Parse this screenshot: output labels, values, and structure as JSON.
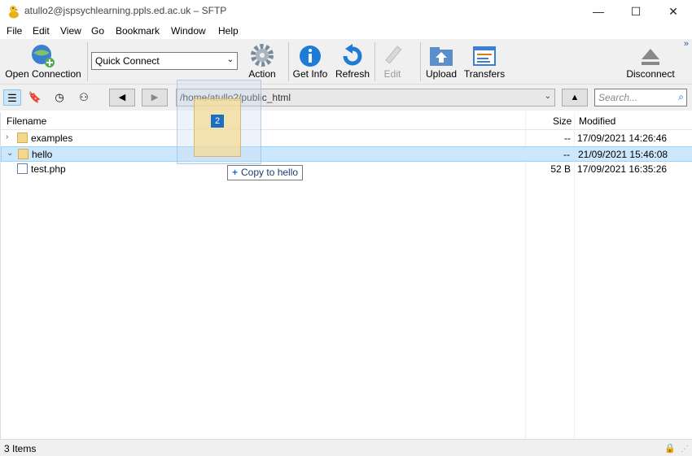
{
  "window": {
    "title": "atullo2@jspsychlearning.ppls.ed.ac.uk – SFTP",
    "minimize": "—",
    "maximize": "☐",
    "close": "✕"
  },
  "menu": [
    "File",
    "Edit",
    "View",
    "Go",
    "Bookmark",
    "Window",
    "Help"
  ],
  "toolbar": {
    "open_connection": "Open Connection",
    "quick_connect": "Quick Connect",
    "action": "Action",
    "get_info": "Get Info",
    "refresh": "Refresh",
    "edit": "Edit",
    "upload": "Upload",
    "transfers": "Transfers",
    "disconnect": "Disconnect",
    "more": "»"
  },
  "navbar": {
    "path": "/home/atullo2/public_html",
    "search_placeholder": "Search..."
  },
  "list": {
    "columns": {
      "filename": "Filename",
      "size": "Size",
      "modified": "Modified"
    },
    "rows": [
      {
        "name": "examples",
        "size": "--",
        "modified": "17/09/2021 14:26:46",
        "type": "folder",
        "expander": "›"
      },
      {
        "name": "hello",
        "size": "--",
        "modified": "21/09/2021 15:46:08",
        "type": "folder",
        "expander": "⌄"
      },
      {
        "name": "test.php",
        "size": "52 B",
        "modified": "17/09/2021 16:35:26",
        "type": "file",
        "expander": ""
      }
    ]
  },
  "drag": {
    "count": "2",
    "tooltip": "Copy to hello"
  },
  "status": {
    "items": "3 Items"
  },
  "colors": {
    "selection": "#cce8ff",
    "accent": "#1a6fc4"
  }
}
